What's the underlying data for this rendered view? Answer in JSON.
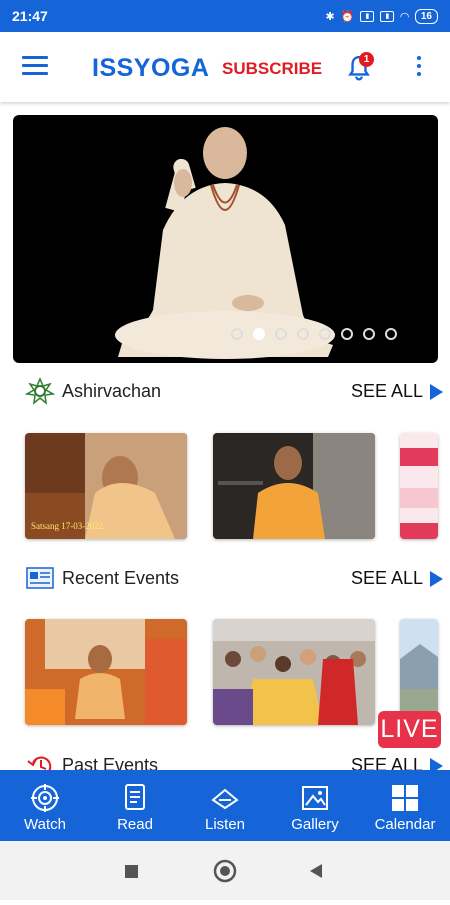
{
  "status_bar": {
    "time": "21:47",
    "battery": "16"
  },
  "app_bar": {
    "brand": "ISSYOGA",
    "subscribe_label": "SUBSCRIBE",
    "notification_count": "1"
  },
  "hero": {
    "slide_count": 8,
    "active_index": 1
  },
  "sections": [
    {
      "title": "Ashirvachan",
      "see_all": "SEE ALL",
      "icon": "lotus-icon"
    },
    {
      "title": "Recent Events",
      "see_all": "SEE ALL",
      "icon": "newspaper-icon"
    },
    {
      "title": "Past Events",
      "see_all": "SEE ALL",
      "icon": "history-icon"
    }
  ],
  "card_captions": {
    "ashirvachan_1": "Satsang 17-03-2022"
  },
  "live_label": "LIVE",
  "bottom_nav": [
    {
      "label": "Watch",
      "icon": "watch-icon"
    },
    {
      "label": "Read",
      "icon": "read-icon"
    },
    {
      "label": "Listen",
      "icon": "listen-icon"
    },
    {
      "label": "Gallery",
      "icon": "gallery-icon"
    },
    {
      "label": "Calendar",
      "icon": "calendar-icon"
    }
  ],
  "colors": {
    "primary": "#1565d8",
    "accent_red": "#e21b23",
    "live": "#e8314a"
  }
}
